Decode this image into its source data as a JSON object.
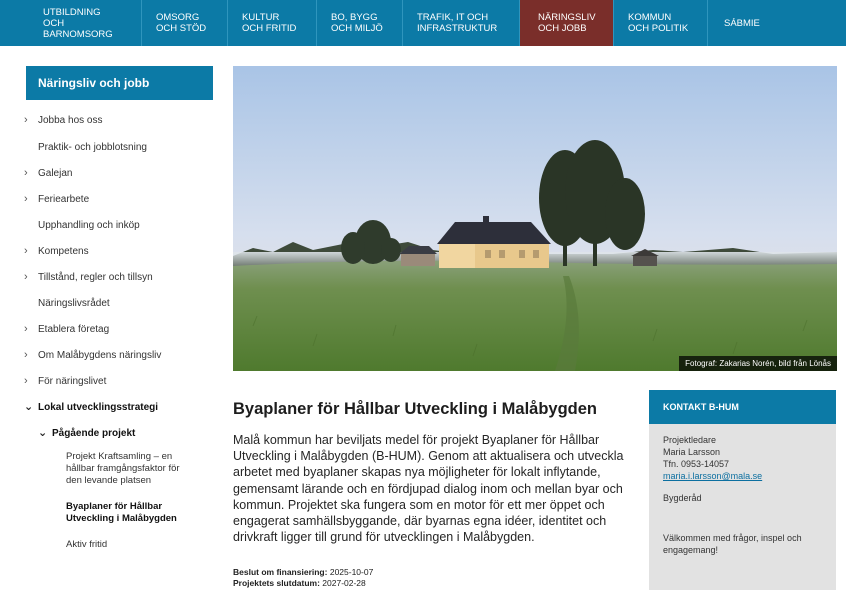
{
  "topnav": {
    "items": [
      {
        "label": "UTBILDNING\nOCH BARNOMSORG",
        "active": false
      },
      {
        "label": "OMSORG\nOCH STÖD",
        "active": false
      },
      {
        "label": "KULTUR\nOCH FRITID",
        "active": false
      },
      {
        "label": "BO, BYGG\nOCH MILJÖ",
        "active": false
      },
      {
        "label": "TRAFIK, IT OCH\nINFRASTRUKTUR",
        "active": false
      },
      {
        "label": "NÄRINGSLIV\nOCH JOBB",
        "active": true
      },
      {
        "label": "KOMMUN\nOCH POLITIK",
        "active": false
      },
      {
        "label": "SÁBMIE",
        "active": false
      }
    ]
  },
  "sidebar": {
    "header": "Näringsliv och jobb",
    "items": [
      {
        "label": "Jobba hos oss",
        "chevron": "›"
      },
      {
        "label": "Praktik- och jobblotsning",
        "chevron": ""
      },
      {
        "label": "Galejan",
        "chevron": "›"
      },
      {
        "label": "Feriearbete",
        "chevron": "›"
      },
      {
        "label": "Upphandling och inköp",
        "chevron": ""
      },
      {
        "label": "Kompetens",
        "chevron": "›"
      },
      {
        "label": "Tillstånd, regler och tillsyn",
        "chevron": "›"
      },
      {
        "label": "Näringslivsrådet",
        "chevron": ""
      },
      {
        "label": "Etablera företag",
        "chevron": "›"
      },
      {
        "label": "Om Malåbygdens näringsliv",
        "chevron": "›"
      },
      {
        "label": "För näringslivet",
        "chevron": "›"
      },
      {
        "label": "Lokal utvecklingsstrategi",
        "chevron": "⌄"
      },
      {
        "label": "Pågående projekt",
        "chevron": "⌄"
      },
      {
        "label": "Projekt Kraftsamling – en hållbar framgångsfaktor för den levande platsen",
        "chevron": ""
      },
      {
        "label": "Byaplaner för Hållbar Utveckling i Malåbygden",
        "chevron": ""
      },
      {
        "label": "Aktiv fritid",
        "chevron": ""
      }
    ]
  },
  "hero": {
    "caption": "Fotograf: Zakarias Norén, bild från Lönås"
  },
  "article": {
    "title": "Byaplaner för Hållbar Utveckling i Malåbygden",
    "body": "Malå kommun har beviljats medel för projekt Byaplaner för Hållbar Utveckling i Malåbygden (B-HUM). Genom att aktualisera och utveckla arbetet med byaplaner skapas nya möjligheter för lokalt inflytande, gemensamt lärande och en fördjupad dialog inom och mellan byar och kommun. Projektet ska fungera som en motor för ett mer öppet och engagerat samhällsbyggande, där byarnas egna idéer, identitet och drivkraft ligger till grund för utvecklingen i Malåbygden.",
    "funding_label": "Beslut om finansiering:",
    "funding_date": "2025-10-07",
    "end_label": "Projektets slutdatum:",
    "end_date": "2027-02-28"
  },
  "contact": {
    "heading": "KONTAKT B-HUM",
    "role": "Projektledare",
    "name": "Maria Larsson",
    "phone": "Tfn. 0953-14057",
    "email": "maria.i.larsson@mala.se",
    "group": "Bygderåd",
    "welcome": "Välkommen med frågor, inspel och engagemang!"
  }
}
